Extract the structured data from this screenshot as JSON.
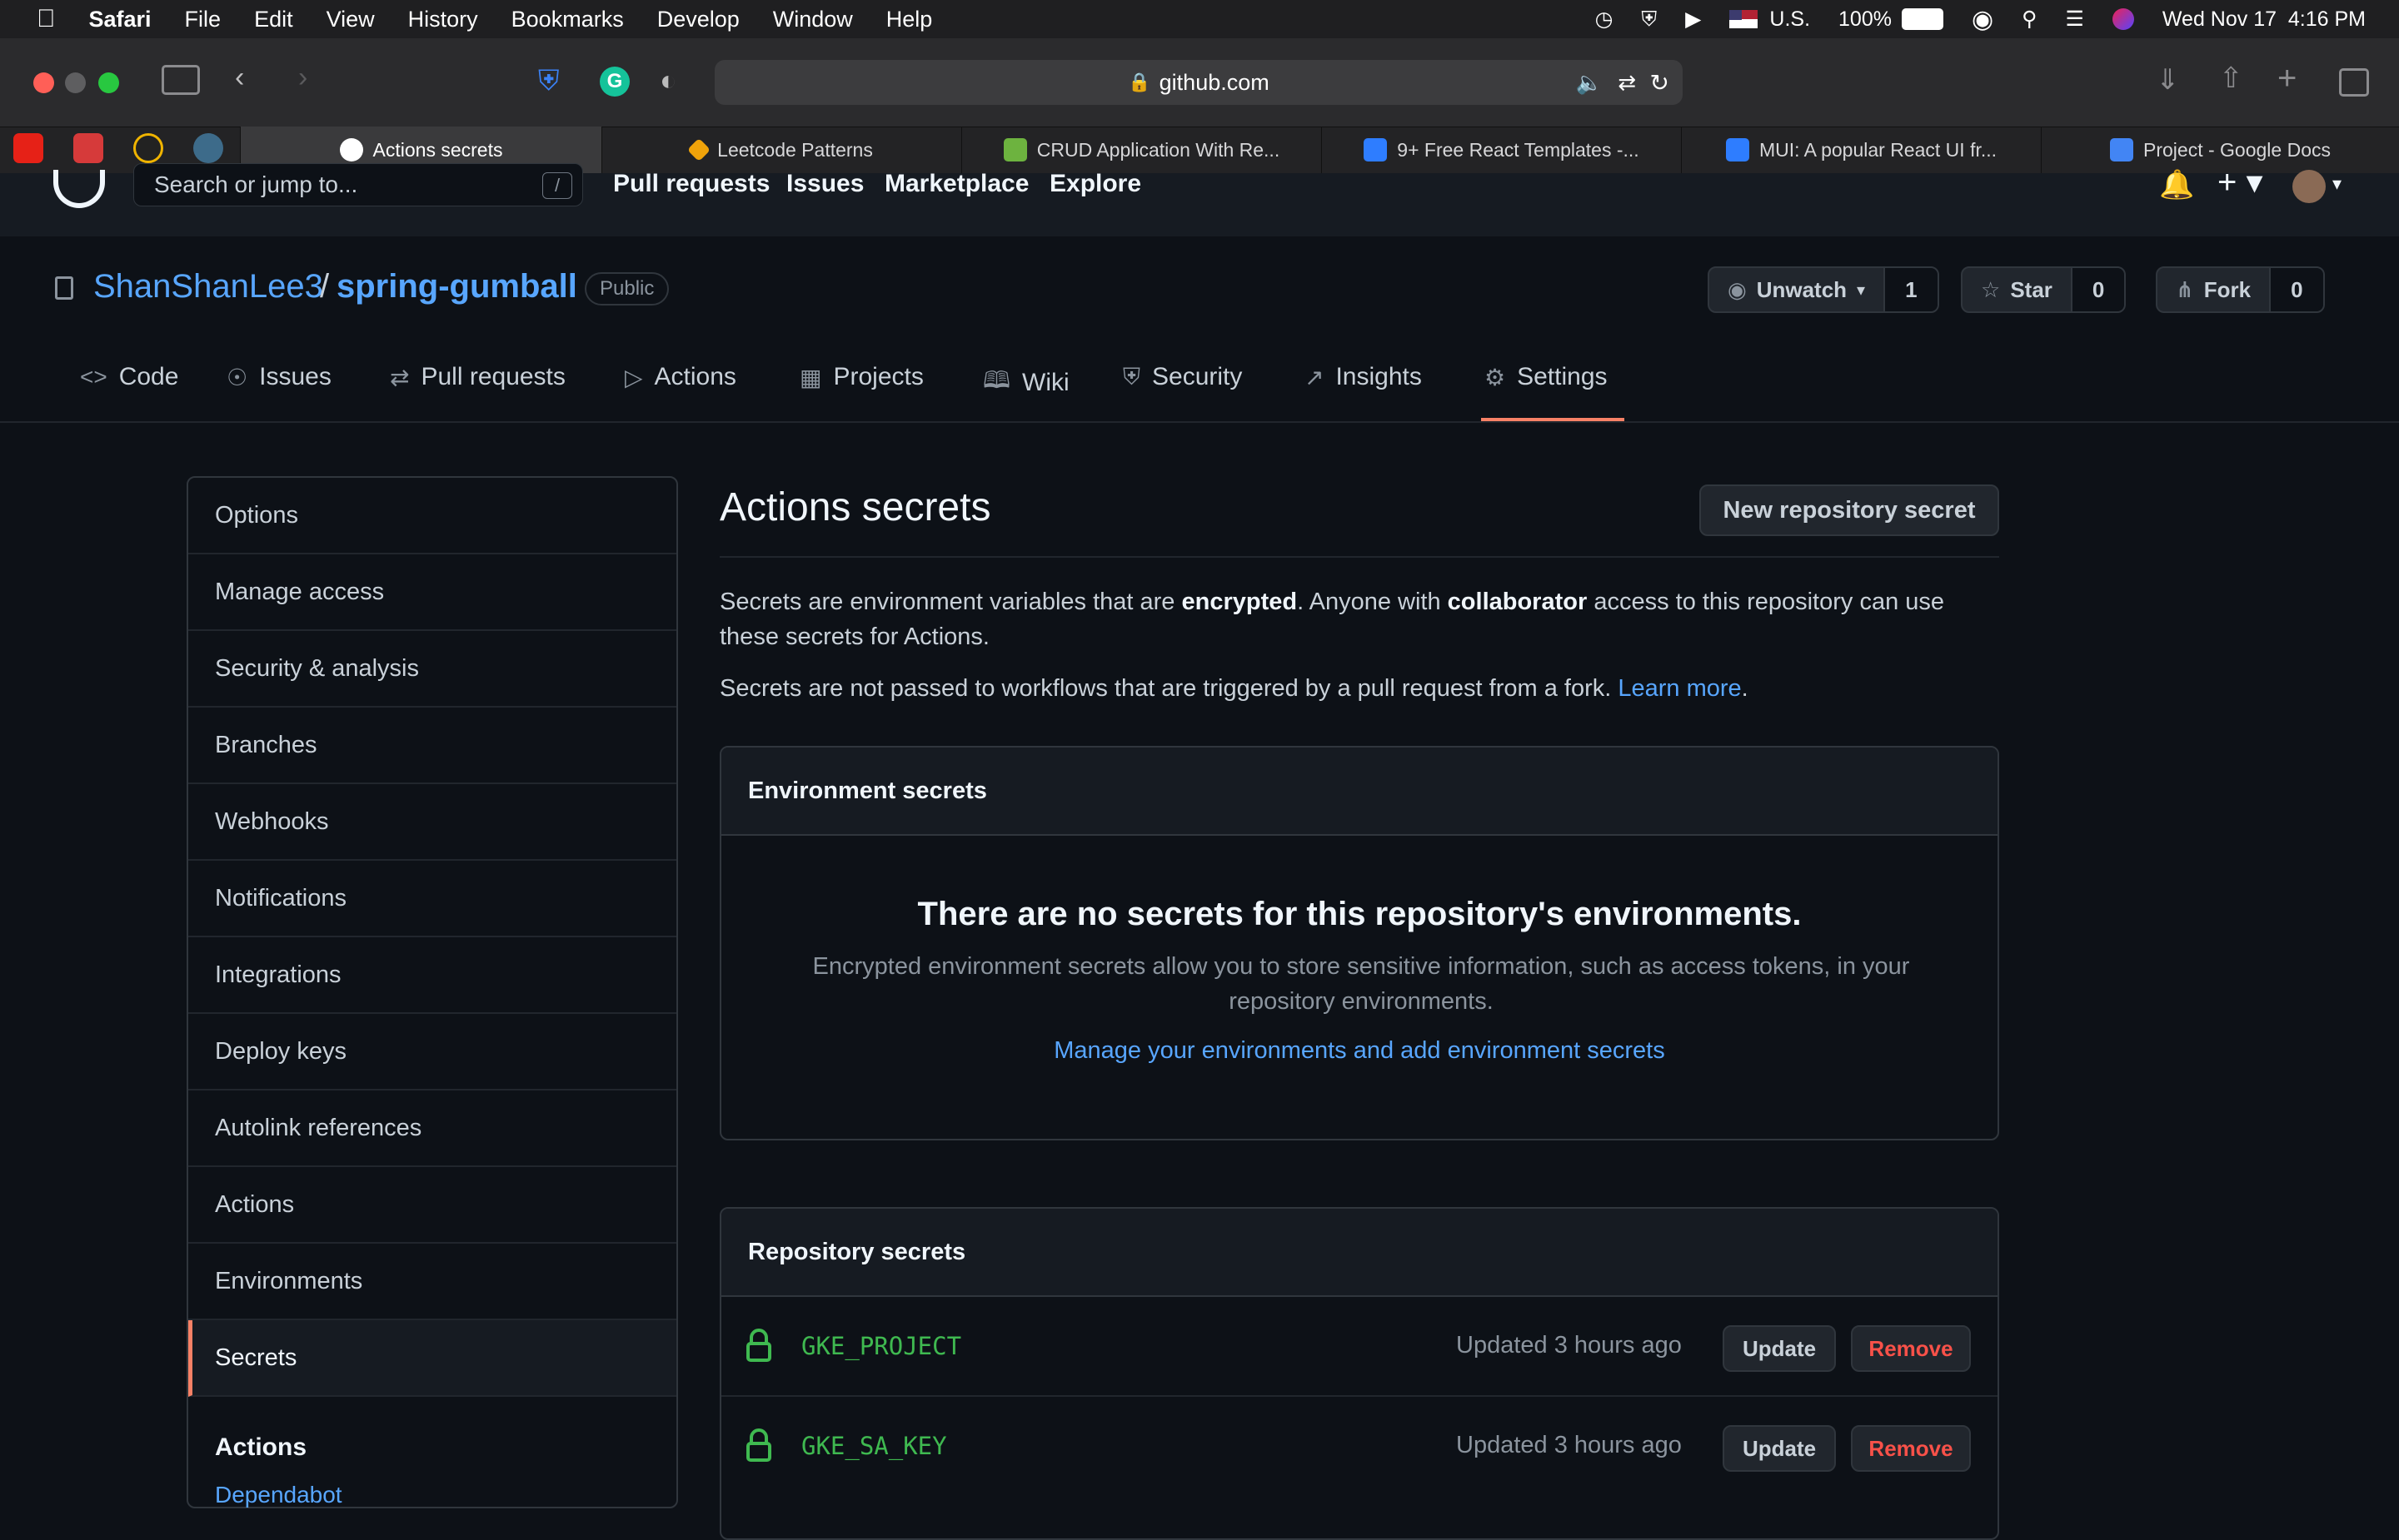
{
  "menubar": {
    "app": "Safari",
    "items": [
      "File",
      "Edit",
      "View",
      "History",
      "Bookmarks",
      "Develop",
      "Window",
      "Help"
    ],
    "input_source": "U.S.",
    "battery": "100%",
    "datetime": "Wed Nov 17  4:16 PM"
  },
  "browser": {
    "url": "github.com",
    "tabs": [
      {
        "label": "Actions secrets",
        "active": true
      },
      {
        "label": "Leetcode Patterns"
      },
      {
        "label": "CRUD Application With Re..."
      },
      {
        "label": "9+ Free React Templates -..."
      },
      {
        "label": "MUI: A popular React UI fr..."
      },
      {
        "label": "Project - Google Docs"
      }
    ]
  },
  "gh": {
    "search_placeholder": "Search or jump to...",
    "search_key": "/",
    "nav": [
      "Pull requests",
      "Issues",
      "Marketplace",
      "Explore"
    ]
  },
  "repo": {
    "owner": "ShanShanLee3",
    "sep": "/",
    "name": "spring-gumball",
    "visibility": "Public",
    "watch_label": "Unwatch",
    "watch_count": "1",
    "star_label": "Star",
    "star_count": "0",
    "fork_label": "Fork",
    "fork_count": "0",
    "tabs": [
      "Code",
      "Issues",
      "Pull requests",
      "Actions",
      "Projects",
      "Wiki",
      "Security",
      "Insights",
      "Settings"
    ]
  },
  "sidebar": {
    "items": [
      "Options",
      "Manage access",
      "Security & analysis",
      "Branches",
      "Webhooks",
      "Notifications",
      "Integrations",
      "Deploy keys",
      "Autolink references",
      "Actions",
      "Environments",
      "Secrets"
    ],
    "section_heading": "Actions",
    "section_link": "Dependabot"
  },
  "main": {
    "title": "Actions secrets",
    "new_button": "New repository secret",
    "intro": {
      "p1a": "Secrets are environment variables that are ",
      "p1b": "encrypted",
      "p1c": ". Anyone with ",
      "p1d": "collaborator",
      "p1e": " access to this repository can use these secrets for Actions.",
      "p2a": "Secrets are not passed to workflows that are triggered by a pull request from a fork. ",
      "p2link": "Learn more",
      "p2end": "."
    },
    "env": {
      "heading": "Environment secrets",
      "blank_title": "There are no secrets for this repository's environments.",
      "blank_text": "Encrypted environment secrets allow you to store sensitive information, such as access tokens, in your repository environments.",
      "blank_link": "Manage your environments and add environment secrets"
    },
    "repo_secrets": {
      "heading": "Repository secrets",
      "rows": [
        {
          "name": "GKE_PROJECT",
          "updated": "Updated 3 hours ago",
          "update": "Update",
          "remove": "Remove"
        },
        {
          "name": "GKE_SA_KEY",
          "updated": "Updated 3 hours ago",
          "update": "Update",
          "remove": "Remove"
        }
      ]
    }
  },
  "colors": {
    "link": "#58a6ff",
    "secret_name": "#3fb950",
    "danger": "#f85149",
    "selected_border": "#f78166"
  }
}
